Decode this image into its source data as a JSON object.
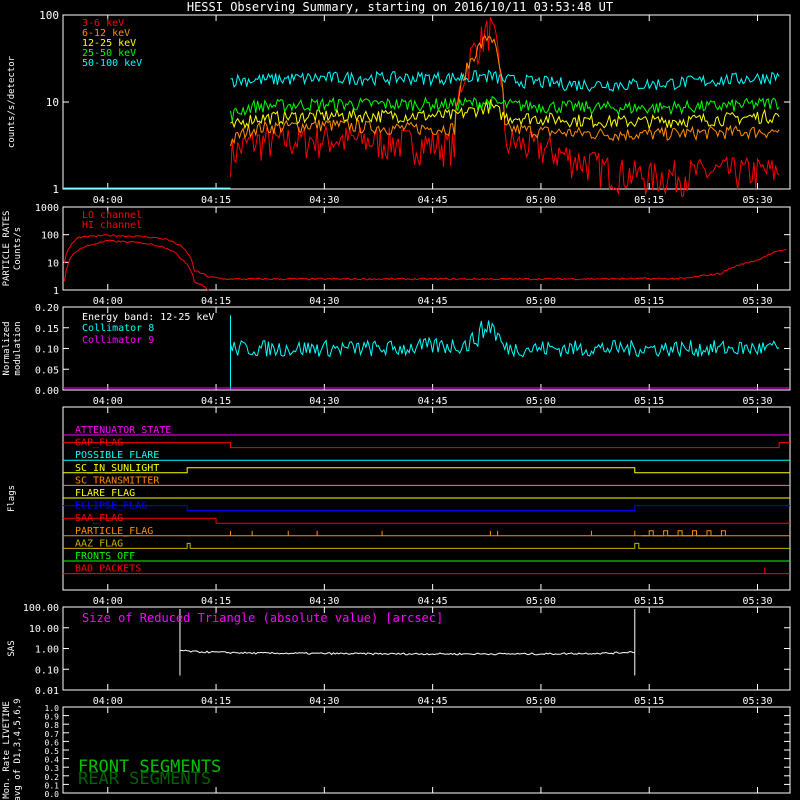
{
  "title": "HESSI Observing Summary, starting on 2016/10/11 03:53:48 UT",
  "colors": {
    "3_6": "#ff0000",
    "6_12": "#ff8c00",
    "12_25": "#ffff00",
    "25_50": "#00ff00",
    "50_100": "#00ffff",
    "magenta": "#ff00ff",
    "blue": "#0000ff",
    "frame": "#ffffff"
  },
  "time_ticks": [
    "04:00",
    "04:15",
    "04:30",
    "04:45",
    "05:00",
    "05:15",
    "05:30"
  ],
  "chart_data": [
    {
      "type": "line",
      "name": "count-rates",
      "ylabel": "counts/s/detector",
      "yscale": "log",
      "ylim": [
        1,
        100
      ],
      "ytick_labels": [
        "1",
        "10",
        "100"
      ],
      "xlim": [
        "03:53:48",
        "05:34:30"
      ],
      "legend": [
        "3-6 keV",
        "6-12 keV",
        "12-25 keV",
        "25-50 keV",
        "50-100 keV"
      ],
      "series": [
        {
          "name": "3-6 keV",
          "x": [
            "04:17",
            "04:20",
            "04:30",
            "04:40",
            "04:48",
            "04:53",
            "04:55",
            "05:00",
            "05:05",
            "05:10",
            "05:15",
            "05:20",
            "05:25",
            "05:30",
            "05:33"
          ],
          "values": [
            2.5,
            3.5,
            3.8,
            3.5,
            3.2,
            70,
            3.5,
            3.0,
            2.2,
            1.6,
            1.4,
            1.5,
            1.6,
            1.6,
            1.6
          ]
        },
        {
          "name": "6-12 keV",
          "x": [
            "04:17",
            "04:20",
            "04:30",
            "04:40",
            "04:48",
            "04:53",
            "04:55",
            "05:00",
            "05:05",
            "05:10",
            "05:15",
            "05:20",
            "05:25",
            "05:30",
            "05:33"
          ],
          "values": [
            3.5,
            5.0,
            5.5,
            5.0,
            5.0,
            60,
            5.0,
            4.6,
            4.4,
            4.3,
            4.3,
            4.4,
            4.5,
            4.6,
            4.6
          ]
        },
        {
          "name": "12-25 keV",
          "x": [
            "04:17",
            "04:20",
            "04:30",
            "04:40",
            "04:48",
            "04:53",
            "04:55",
            "05:00",
            "05:05",
            "05:10",
            "05:15",
            "05:20",
            "05:25",
            "05:30",
            "05:33"
          ],
          "values": [
            5.0,
            6.5,
            7.0,
            7.0,
            7.0,
            9.0,
            6.8,
            6.5,
            6.2,
            6.0,
            6.0,
            6.2,
            6.4,
            6.8,
            7.0
          ]
        },
        {
          "name": "25-50 keV",
          "x": [
            "04:17",
            "04:20",
            "04:30",
            "04:40",
            "04:48",
            "04:53",
            "04:55",
            "05:00",
            "05:05",
            "05:10",
            "05:15",
            "05:20",
            "05:25",
            "05:30",
            "05:33"
          ],
          "values": [
            7.0,
            9.0,
            9.5,
            9.5,
            9.5,
            10.0,
            9.3,
            9.0,
            8.8,
            8.6,
            8.6,
            8.8,
            9.0,
            9.5,
            10.0
          ]
        },
        {
          "name": "50-100 keV",
          "x": [
            "04:17",
            "04:20",
            "04:30",
            "04:40",
            "04:48",
            "04:53",
            "04:55",
            "05:00",
            "05:05",
            "05:10",
            "05:15",
            "05:20",
            "05:25",
            "05:30",
            "05:33"
          ],
          "values": [
            18,
            18,
            19,
            19,
            19,
            20,
            18,
            17,
            16,
            16,
            16,
            17,
            18,
            19,
            20
          ]
        }
      ]
    },
    {
      "type": "line",
      "name": "particle-rates",
      "ylabel": "PARTICLE RATES\nCounts/s",
      "yscale": "log",
      "ylim": [
        1,
        1000
      ],
      "ytick_labels": [
        "1",
        "10",
        "100",
        "1000"
      ],
      "legend": [
        "LO channel",
        "HI channel"
      ],
      "series": [
        {
          "name": "LO channel",
          "x": [
            "03:54",
            "03:56",
            "04:00",
            "04:05",
            "04:08",
            "04:10",
            "04:12",
            "04:14",
            "04:16",
            "04:20",
            "04:40",
            "05:00",
            "05:20",
            "05:25",
            "05:30",
            "05:34"
          ],
          "values": [
            10,
            80,
            95,
            85,
            70,
            40,
            5,
            3,
            2.5,
            2.5,
            2.5,
            2.5,
            2.6,
            4,
            12,
            30
          ]
        },
        {
          "name": "HI channel",
          "x": [
            "03:54",
            "03:56",
            "04:00",
            "04:05",
            "04:08",
            "04:10",
            "04:12",
            "04:14"
          ],
          "values": [
            2,
            30,
            60,
            50,
            35,
            15,
            2,
            1
          ]
        }
      ]
    },
    {
      "type": "line",
      "name": "modulation",
      "ylabel": "Normalized\nmodulation",
      "ylim": [
        0.0,
        0.2
      ],
      "ytick_labels": [
        "0.00",
        "0.05",
        "0.10",
        "0.15",
        "0.20"
      ],
      "legend_title": "Energy band: 12-25 keV",
      "legend": [
        "Collimator 8",
        "Collimator 9"
      ],
      "series": [
        {
          "name": "Collimator 8",
          "x": [
            "04:17",
            "04:20",
            "04:30",
            "04:40",
            "04:50",
            "04:53",
            "04:55",
            "05:00",
            "05:10",
            "05:20",
            "05:30",
            "05:33"
          ],
          "values": [
            0.1,
            0.1,
            0.1,
            0.1,
            0.11,
            0.16,
            0.1,
            0.1,
            0.1,
            0.1,
            0.1,
            0.1
          ]
        },
        {
          "name": "Collimator 9",
          "x": [
            "03:54",
            "05:34"
          ],
          "values": [
            0.0,
            0.0
          ]
        }
      ]
    },
    {
      "type": "line",
      "name": "flags",
      "ylabel": "Flags",
      "flags": [
        {
          "label": "ATTENUATOR_STATE",
          "color": "#ff00ff"
        },
        {
          "label": "GAP_FLAG",
          "color": "#ff0000"
        },
        {
          "label": "POSSIBLE_FLARE",
          "color": "#00ffff"
        },
        {
          "label": "SC_IN_SUNLIGHT",
          "color": "#ffff00"
        },
        {
          "label": "SC_TRANSMITTER",
          "color": "#ff8c00"
        },
        {
          "label": "FLARE_FLAG",
          "color": "#ffff00"
        },
        {
          "label": "ECLIPSE_FLAG",
          "color": "#0000ff"
        },
        {
          "label": "SAA_FLAG",
          "color": "#ff0000"
        },
        {
          "label": "PARTICLE_FLAG",
          "color": "#ff8c00"
        },
        {
          "label": "AAZ_FLAG",
          "color": "#c8b400"
        },
        {
          "label": "FRONTS_OFF",
          "color": "#00ff00"
        },
        {
          "label": "BAD_PACKETS",
          "color": "#ff0000"
        }
      ]
    },
    {
      "type": "line",
      "name": "sas",
      "ylabel": "SAS",
      "yscale": "log",
      "ylim": [
        0.01,
        100
      ],
      "ytick_labels": [
        "0.01",
        "0.10",
        "1.00",
        "10.00",
        "100.00"
      ],
      "legend": [
        "Size of Reduced Triangle (absolute value) [arcsec]"
      ],
      "series": [
        {
          "name": "Size of Reduced Triangle (absolute value) [arcsec]",
          "x": [
            "04:10",
            "04:12",
            "04:20",
            "04:40",
            "05:00",
            "05:10",
            "05:13"
          ],
          "values": [
            0.8,
            0.7,
            0.6,
            0.55,
            0.55,
            0.6,
            0.7
          ]
        }
      ]
    },
    {
      "type": "line",
      "name": "livetime",
      "ylabel": "Mon. Rate LIVETIME\navg of D1,3,4,5,6,9",
      "ylim": [
        0.0,
        1.0
      ],
      "ytick_labels": [
        "0.0",
        "0.1",
        "0.2",
        "0.3",
        "0.4",
        "0.5",
        "0.6",
        "0.7",
        "0.8",
        "0.9",
        "1.0"
      ],
      "legend": [
        "FRONT SEGMENTS",
        "REAR SEGMENTS"
      ]
    }
  ]
}
